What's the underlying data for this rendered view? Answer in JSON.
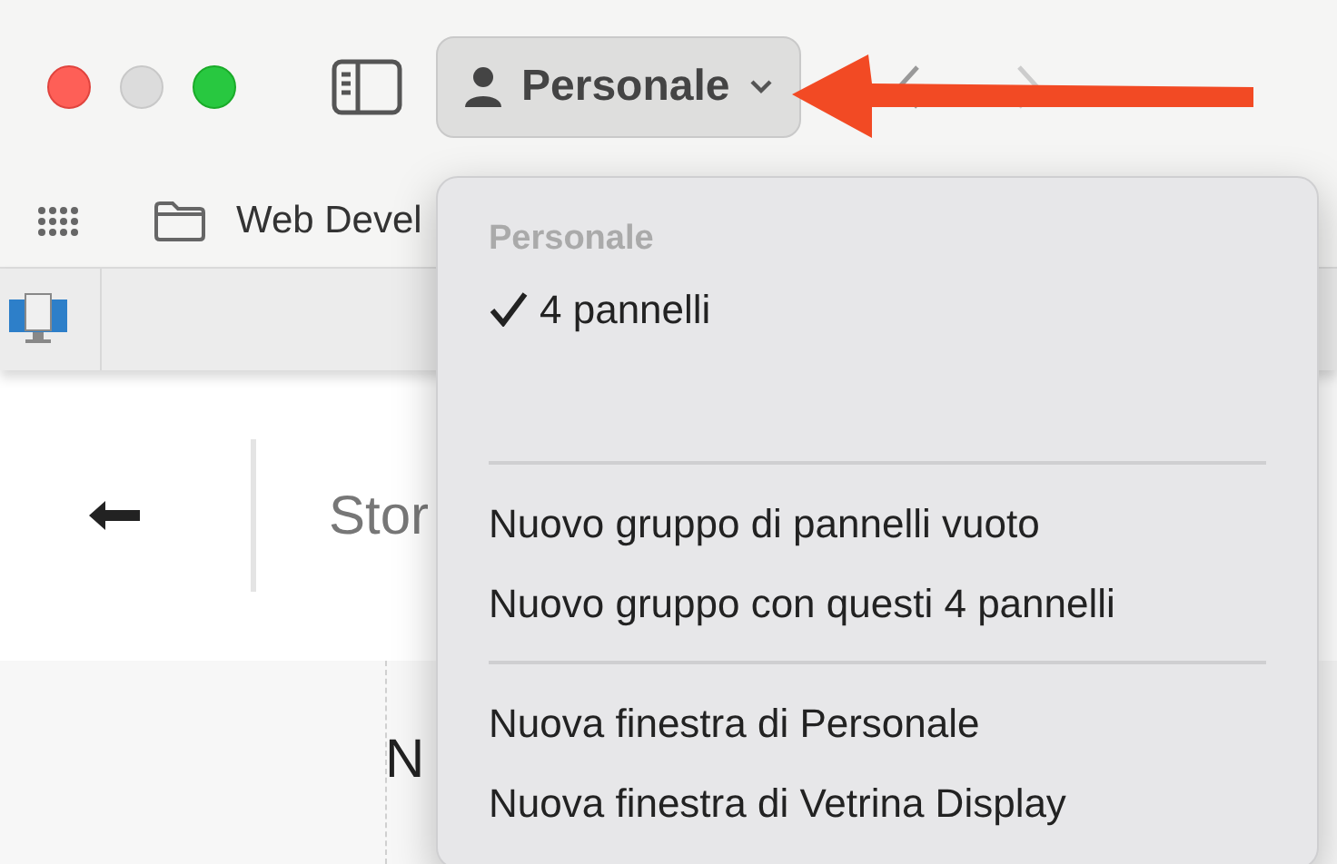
{
  "toolbar": {
    "profile_button": {
      "label": "Personale",
      "expanded": true
    }
  },
  "bookmarks": [
    {
      "label": "Web Devel"
    }
  ],
  "page": {
    "header_title": "Stor",
    "body_lines": [
      "N"
    ]
  },
  "menu": {
    "header": "Personale",
    "items": [
      {
        "kind": "check",
        "label": "4 pannelli",
        "checked": true
      },
      {
        "kind": "spacer"
      },
      {
        "kind": "separator"
      },
      {
        "kind": "item",
        "label": "Nuovo gruppo di pannelli vuoto"
      },
      {
        "kind": "item",
        "label": "Nuovo gruppo con questi 4 pannelli"
      },
      {
        "kind": "separator"
      },
      {
        "kind": "item",
        "label": "Nuova finestra di Personale"
      },
      {
        "kind": "item",
        "label": "Nuova finestra di Vetrina Display"
      }
    ]
  }
}
